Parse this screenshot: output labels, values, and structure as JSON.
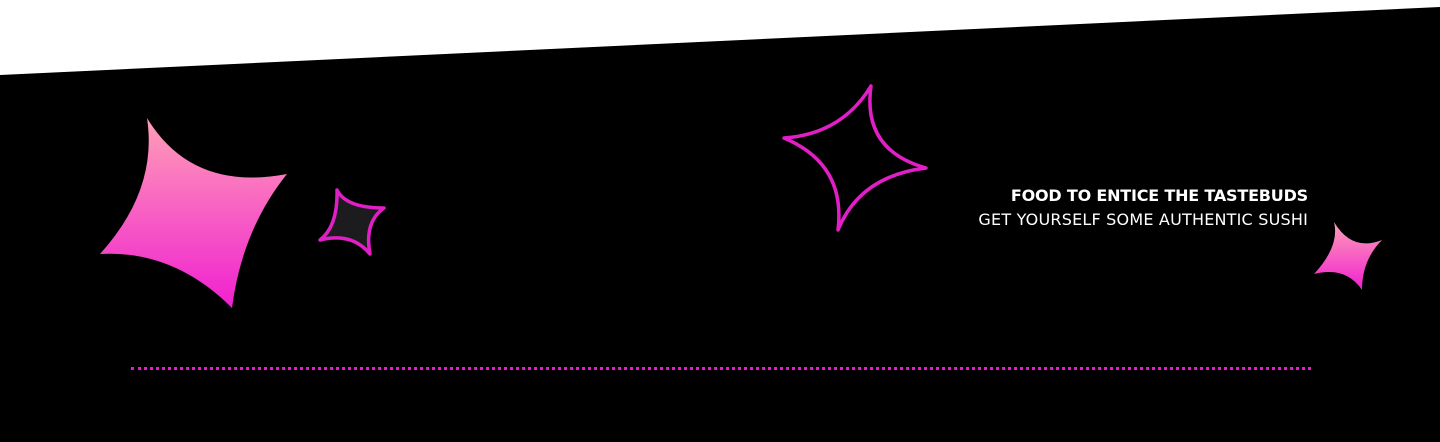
{
  "banner": {
    "title": "FOOD TO ENTICE THE TASTEBUDS",
    "subtitle": "GET YOURSELF SOME AUTHENTIC SUSHI"
  },
  "colors": {
    "background": "#000000",
    "top_area": "#ffffff",
    "accent": "#e21fc7",
    "gradient_top": "#ff9fb7",
    "gradient_bottom": "#f020d0",
    "star_fill_dark": "#1c1c1e"
  },
  "decorations": {
    "icons": [
      "gradient-sparkle-icon",
      "outlined-dark-sparkle-icon",
      "outlined-sparkle-icon",
      "small-gradient-sparkle-icon"
    ]
  }
}
